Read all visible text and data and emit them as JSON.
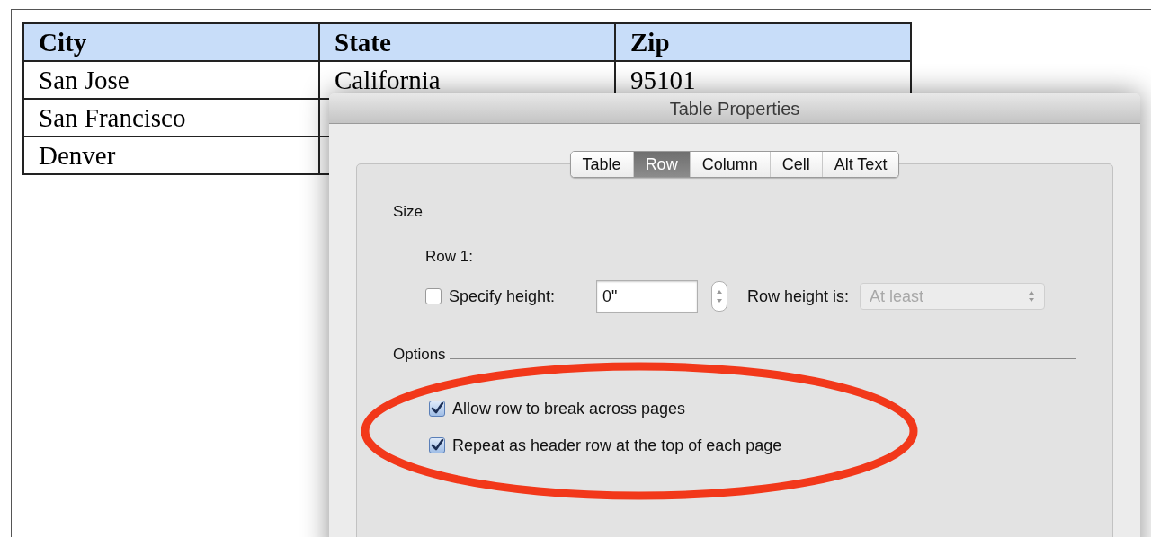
{
  "document_table": {
    "columns": [
      "City",
      "State",
      "Zip"
    ],
    "rows": [
      [
        "San Jose",
        "California",
        "95101"
      ],
      [
        "San Francisco"
      ],
      [
        "Denver"
      ]
    ]
  },
  "dialog": {
    "title": "Table Properties",
    "tabs": [
      {
        "label": "Table",
        "selected": false
      },
      {
        "label": "Row",
        "selected": true
      },
      {
        "label": "Column",
        "selected": false
      },
      {
        "label": "Cell",
        "selected": false
      },
      {
        "label": "Alt Text",
        "selected": false
      }
    ],
    "size_section": {
      "label": "Size",
      "row_label": "Row 1:",
      "specify_height": {
        "label": "Specify height:",
        "checked": false
      },
      "height_value": "0\"",
      "row_height_label": "Row height is:",
      "row_height_select": {
        "value": "At least",
        "disabled": true
      }
    },
    "options_section": {
      "label": "Options",
      "options": [
        {
          "label": "Allow row to break across pages",
          "checked": true
        },
        {
          "label": "Repeat as header row at the top of each page",
          "checked": true
        }
      ]
    }
  },
  "annotation": {
    "kind": "ellipse"
  }
}
